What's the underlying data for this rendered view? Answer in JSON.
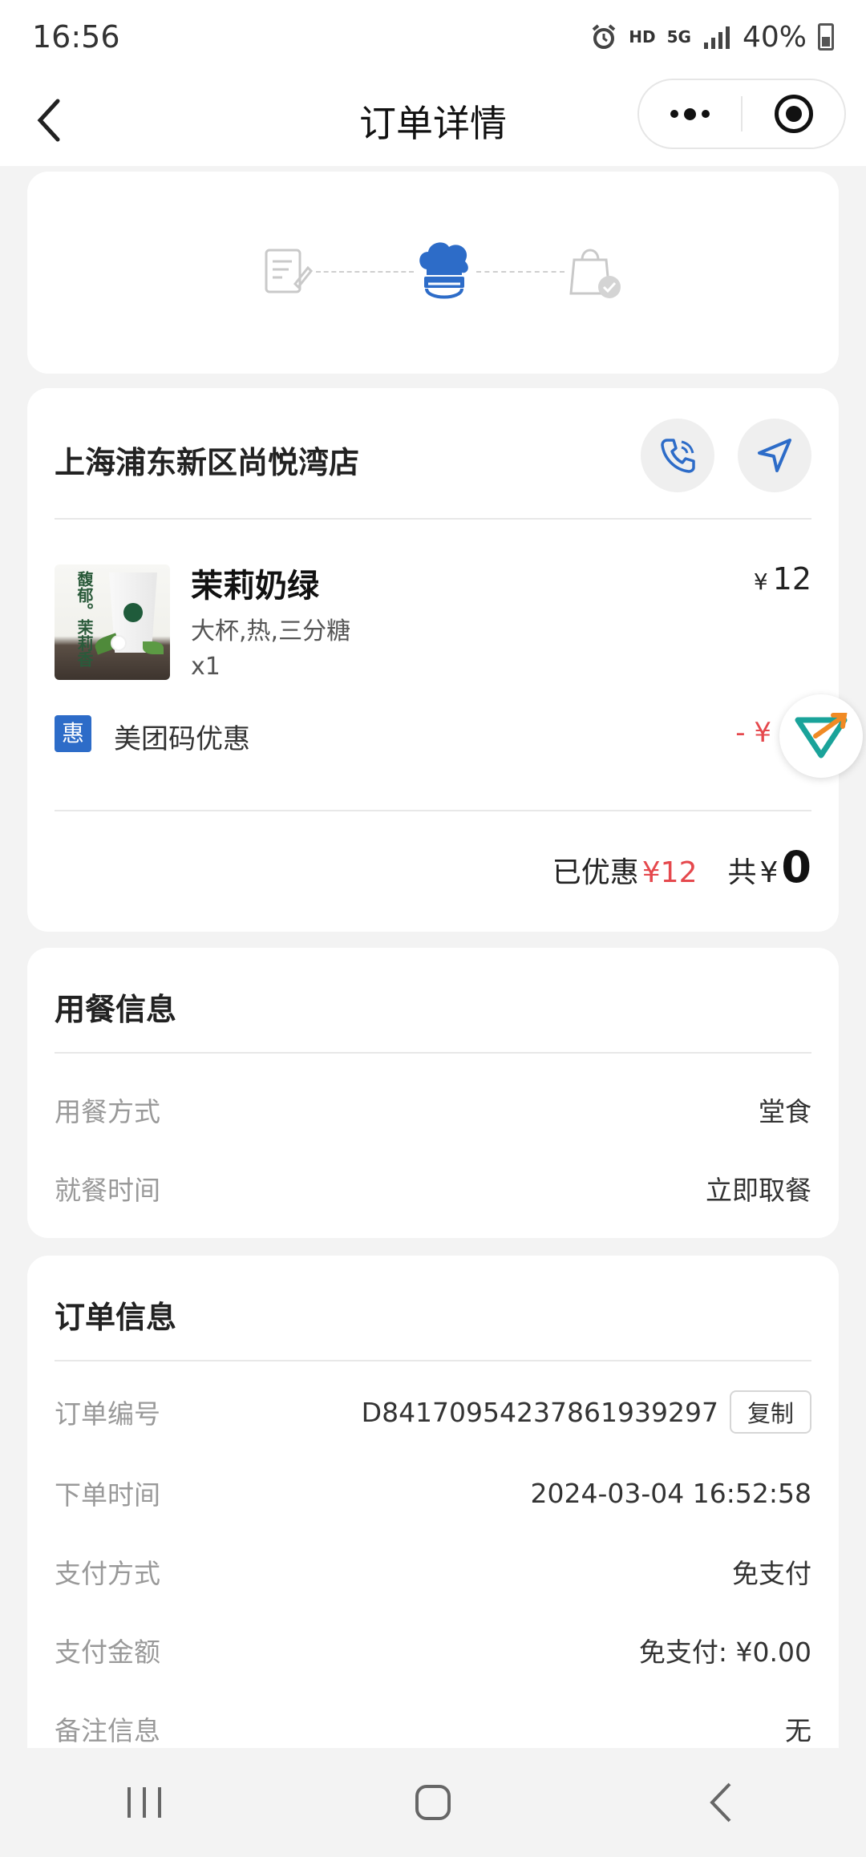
{
  "status_bar": {
    "time": "16:56",
    "hd": "HD",
    "network": "5G",
    "battery": "40%"
  },
  "header": {
    "title": "订单详情"
  },
  "store": {
    "name": "上海浦东新区尚悦湾店"
  },
  "product": {
    "name": "茉莉奶绿",
    "spec": "大杯,热,三分糖",
    "qty": "x1",
    "price_symbol": "¥",
    "price": "12",
    "image_text": "馥郁。茉莉香"
  },
  "discount": {
    "badge": "惠",
    "label": "美团码优惠",
    "amount": "- ¥"
  },
  "totals": {
    "discounted_label": "已优惠",
    "discounted_value": "¥12",
    "total_label": "共",
    "total_symbol": "¥",
    "total_value": "0"
  },
  "meal_info": {
    "title": "用餐信息",
    "rows": [
      {
        "key": "用餐方式",
        "value": "堂食"
      },
      {
        "key": "就餐时间",
        "value": "立即取餐"
      }
    ]
  },
  "order_info": {
    "title": "订单信息",
    "copy_label": "复制",
    "rows": [
      {
        "key": "订单编号",
        "value": "D84170954237861939297"
      },
      {
        "key": "下单时间",
        "value": "2024-03-04 16:52:58"
      },
      {
        "key": "支付方式",
        "value": "免支付"
      },
      {
        "key": "支付金额",
        "value": "免支付: ¥0.00"
      },
      {
        "key": "备注信息",
        "value": "无"
      }
    ]
  },
  "colors": {
    "accent_blue": "#2d6cc8",
    "discount_red": "#e5484d"
  }
}
